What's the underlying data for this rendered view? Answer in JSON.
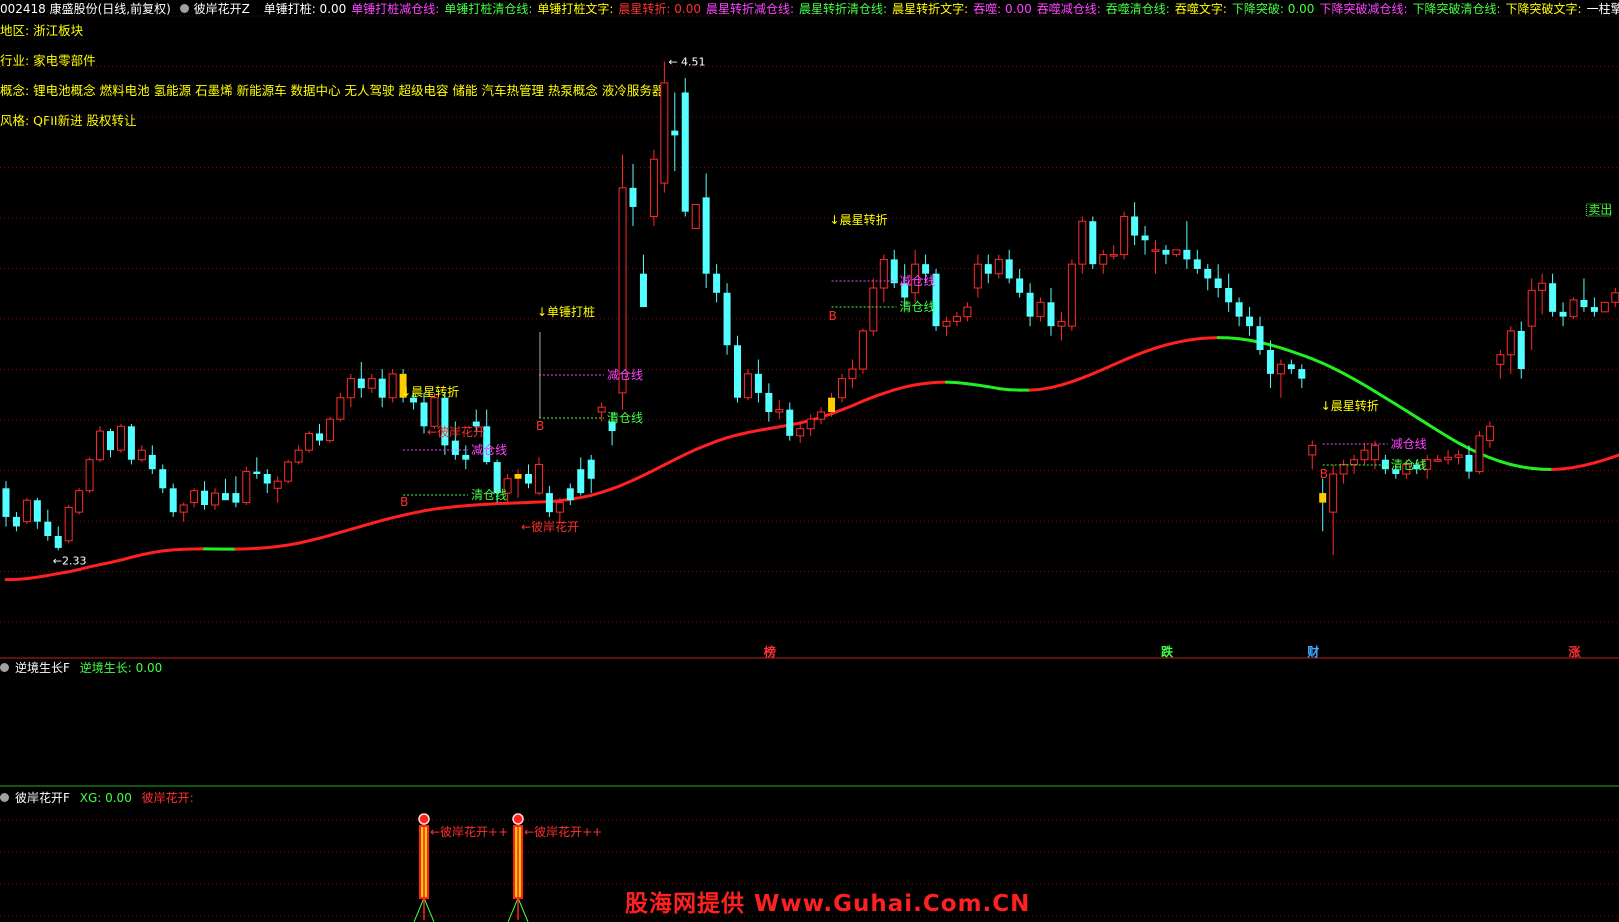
{
  "header": {
    "stock": "002418 康盛股份(日线,前复权)",
    "formula": "彼岸花开Z",
    "items": [
      {
        "label": "单锤打桩: 0.00",
        "color": "#ffffff"
      },
      {
        "label": "单锤打桩减仓线:",
        "color": "#ff44ff"
      },
      {
        "label": "单锤打桩清仓线:",
        "color": "#44ff44"
      },
      {
        "label": "单锤打桩文字:",
        "color": "#ffff00"
      },
      {
        "label": "晨星转折: 0.00",
        "color": "#ff3030"
      },
      {
        "label": "晨星转折减仓线:",
        "color": "#ff44ff"
      },
      {
        "label": "晨星转折清仓线:",
        "color": "#44ff44"
      },
      {
        "label": "晨星转折文字:",
        "color": "#ffff00"
      },
      {
        "label": "吞噬: 0.00",
        "color": "#ff44ff"
      },
      {
        "label": "吞噬减仓线:",
        "color": "#ff44ff"
      },
      {
        "label": "吞噬清仓线:",
        "color": "#44ff44"
      },
      {
        "label": "吞噬文字:",
        "color": "#ffff00"
      },
      {
        "label": "下降突破: 0.00",
        "color": "#44ff44"
      },
      {
        "label": "下降突破减仓线:",
        "color": "#ff44ff"
      },
      {
        "label": "下降突破清仓线:",
        "color": "#44ff44"
      },
      {
        "label": "下降突破文字:",
        "color": "#ffff00"
      },
      {
        "label": "一柱擎天: 0.0",
        "color": "#ffffff"
      }
    ]
  },
  "info": {
    "region": "地区: 浙江板块",
    "industry": "行业: 家电零部件",
    "concept": "概念: 锂电池概念 燃料电池 氢能源 石墨烯 新能源车 数据中心 无人驾驶 超级电容 储能 汽车热管理 热泵概念 液冷服务器",
    "style": "风格: QFII新进 股权转让"
  },
  "panel2": {
    "title": "逆境生长F",
    "value": "逆境生长: 0.00"
  },
  "panel3": {
    "title": "彼岸花开F",
    "xg": "XG: 0.00",
    "label": "彼岸花开:"
  },
  "watermark": "股海网提供 Www.Guhai.Com.CN",
  "colors": {
    "up": "#ff2a2a",
    "down": "#54ffff",
    "ma_up": "#ff2020",
    "ma_down": "#22ee22",
    "signal": "#ffcc00",
    "grid": "#8b0000"
  },
  "chart_data": {
    "type": "candlestick",
    "max_label": "4.51",
    "min_label": "2.33",
    "ylim": [
      2.0,
      4.6
    ],
    "candles": [
      [
        2.72,
        2.75,
        2.56,
        2.6
      ],
      [
        2.6,
        2.62,
        2.54,
        2.56
      ],
      [
        2.58,
        2.68,
        2.57,
        2.67
      ],
      [
        2.67,
        2.68,
        2.55,
        2.58
      ],
      [
        2.58,
        2.63,
        2.5,
        2.52
      ],
      [
        2.52,
        2.56,
        2.46,
        2.47
      ],
      [
        2.5,
        2.65,
        2.49,
        2.64
      ],
      [
        2.62,
        2.72,
        2.61,
        2.71
      ],
      [
        2.71,
        2.85,
        2.7,
        2.84
      ],
      [
        2.84,
        2.98,
        2.83,
        2.96
      ],
      [
        2.96,
        2.97,
        2.85,
        2.88
      ],
      [
        2.88,
        2.99,
        2.87,
        2.98
      ],
      [
        2.98,
        2.99,
        2.82,
        2.84
      ],
      [
        2.84,
        2.9,
        2.83,
        2.88
      ],
      [
        2.86,
        2.9,
        2.78,
        2.8
      ],
      [
        2.8,
        2.82,
        2.7,
        2.72
      ],
      [
        2.72,
        2.74,
        2.6,
        2.62
      ],
      [
        2.62,
        2.66,
        2.58,
        2.65
      ],
      [
        2.66,
        2.72,
        2.64,
        2.71
      ],
      [
        2.71,
        2.75,
        2.63,
        2.65
      ],
      [
        2.65,
        2.72,
        2.63,
        2.7
      ],
      [
        2.7,
        2.76,
        2.68,
        2.67
      ],
      [
        2.7,
        2.77,
        2.64,
        2.66
      ],
      [
        2.66,
        2.81,
        2.65,
        2.79
      ],
      [
        2.79,
        2.85,
        2.76,
        2.78
      ],
      [
        2.78,
        2.8,
        2.7,
        2.74
      ],
      [
        2.72,
        2.77,
        2.66,
        2.75
      ],
      [
        2.75,
        2.84,
        2.74,
        2.83
      ],
      [
        2.83,
        2.9,
        2.82,
        2.88
      ],
      [
        2.88,
        2.96,
        2.87,
        2.95
      ],
      [
        2.95,
        2.99,
        2.9,
        2.92
      ],
      [
        2.92,
        3.02,
        2.91,
        3.01
      ],
      [
        3.01,
        3.12,
        3.0,
        3.1
      ],
      [
        3.1,
        3.2,
        3.06,
        3.18
      ],
      [
        3.18,
        3.25,
        3.1,
        3.14
      ],
      [
        3.14,
        3.2,
        3.12,
        3.18
      ],
      [
        3.18,
        3.22,
        3.06,
        3.1
      ],
      [
        3.1,
        3.22,
        3.08,
        3.2
      ],
      [
        3.2,
        3.22,
        3.08,
        3.1
      ],
      [
        3.1,
        3.12,
        3.05,
        3.08
      ],
      [
        3.08,
        3.12,
        2.95,
        2.98
      ],
      [
        2.98,
        3.12,
        2.97,
        3.1
      ],
      [
        3.1,
        3.12,
        2.86,
        2.9
      ],
      [
        2.92,
        3.0,
        2.84,
        2.86
      ],
      [
        2.86,
        2.9,
        2.8,
        2.84
      ],
      [
        3.0,
        3.05,
        2.96,
        2.98
      ],
      [
        2.98,
        3.05,
        2.82,
        2.83
      ],
      [
        2.83,
        2.84,
        2.66,
        2.7
      ],
      [
        2.7,
        2.78,
        2.66,
        2.76
      ],
      [
        2.76,
        2.8,
        2.68,
        2.78
      ],
      [
        2.78,
        2.82,
        2.72,
        2.74
      ],
      [
        2.7,
        2.85,
        2.69,
        2.82
      ],
      [
        2.7,
        2.73,
        2.6,
        2.62
      ],
      [
        2.62,
        2.68,
        2.58,
        2.66
      ],
      [
        2.72,
        2.74,
        2.65,
        2.67
      ],
      [
        2.8,
        2.85,
        2.69,
        2.7
      ],
      [
        2.84,
        2.86,
        2.7,
        2.76
      ],
      [
        3.04,
        3.08,
        3.0,
        3.06
      ],
      [
        3.0,
        3.04,
        2.9,
        2.96
      ],
      [
        3.12,
        4.12,
        3.05,
        3.98
      ],
      [
        3.98,
        4.08,
        3.82,
        3.9
      ],
      [
        3.62,
        3.7,
        3.48,
        3.48
      ],
      [
        3.86,
        4.14,
        3.82,
        4.1
      ],
      [
        4.0,
        4.51,
        3.96,
        4.42
      ],
      [
        4.22,
        4.38,
        4.05,
        4.2
      ],
      [
        4.38,
        4.44,
        3.86,
        3.88
      ],
      [
        3.81,
        3.91,
        3.81,
        3.91
      ],
      [
        3.94,
        4.04,
        3.56,
        3.62
      ],
      [
        3.62,
        3.66,
        3.5,
        3.54
      ],
      [
        3.54,
        3.58,
        3.28,
        3.32
      ],
      [
        3.32,
        3.36,
        3.08,
        3.1
      ],
      [
        3.1,
        3.22,
        3.09,
        3.2
      ],
      [
        3.2,
        3.26,
        3.08,
        3.12
      ],
      [
        3.12,
        3.16,
        3.0,
        3.04
      ],
      [
        3.04,
        3.09,
        3.01,
        3.05
      ],
      [
        3.05,
        3.08,
        2.92,
        2.94
      ],
      [
        2.94,
        3.0,
        2.91,
        2.97
      ],
      [
        2.97,
        3.03,
        2.94,
        3.01
      ],
      [
        3.01,
        3.06,
        2.99,
        3.04
      ],
      [
        3.04,
        3.12,
        3.02,
        3.1
      ],
      [
        3.1,
        3.2,
        3.08,
        3.18
      ],
      [
        3.18,
        3.26,
        3.14,
        3.22
      ],
      [
        3.22,
        3.39,
        3.2,
        3.38
      ],
      [
        3.38,
        3.6,
        3.36,
        3.56
      ],
      [
        3.56,
        3.7,
        3.5,
        3.68
      ],
      [
        3.68,
        3.72,
        3.56,
        3.58
      ],
      [
        3.58,
        3.66,
        3.48,
        3.52
      ],
      [
        3.54,
        3.72,
        3.5,
        3.66
      ],
      [
        3.66,
        3.7,
        3.58,
        3.62
      ],
      [
        3.62,
        3.64,
        3.38,
        3.4
      ],
      [
        3.4,
        3.44,
        3.36,
        3.42
      ],
      [
        3.42,
        3.46,
        3.4,
        3.44
      ],
      [
        3.44,
        3.5,
        3.42,
        3.48
      ],
      [
        3.56,
        3.7,
        3.52,
        3.66
      ],
      [
        3.66,
        3.7,
        3.58,
        3.62
      ],
      [
        3.62,
        3.7,
        3.6,
        3.68
      ],
      [
        3.68,
        3.72,
        3.58,
        3.6
      ],
      [
        3.6,
        3.64,
        3.52,
        3.54
      ],
      [
        3.54,
        3.58,
        3.4,
        3.44
      ],
      [
        3.44,
        3.52,
        3.42,
        3.5
      ],
      [
        3.5,
        3.56,
        3.36,
        3.4
      ],
      [
        3.4,
        3.46,
        3.34,
        3.42
      ],
      [
        3.4,
        3.68,
        3.38,
        3.66
      ],
      [
        3.66,
        3.86,
        3.62,
        3.84
      ],
      [
        3.84,
        3.86,
        3.64,
        3.66
      ],
      [
        3.66,
        3.72,
        3.62,
        3.7
      ],
      [
        3.7,
        3.74,
        3.68,
        3.7
      ],
      [
        3.7,
        3.88,
        3.68,
        3.86
      ],
      [
        3.86,
        3.92,
        3.74,
        3.78
      ],
      [
        3.78,
        3.82,
        3.7,
        3.76
      ],
      [
        3.72,
        3.76,
        3.62,
        3.72
      ],
      [
        3.72,
        3.74,
        3.66,
        3.7
      ],
      [
        3.7,
        3.72,
        3.69,
        3.72
      ],
      [
        3.72,
        3.84,
        3.64,
        3.68
      ],
      [
        3.68,
        3.72,
        3.62,
        3.64
      ],
      [
        3.64,
        3.66,
        3.55,
        3.6
      ],
      [
        3.6,
        3.66,
        3.52,
        3.56
      ],
      [
        3.56,
        3.62,
        3.46,
        3.5
      ],
      [
        3.5,
        3.52,
        3.4,
        3.44
      ],
      [
        3.44,
        3.48,
        3.36,
        3.4
      ],
      [
        3.4,
        3.44,
        3.28,
        3.3
      ],
      [
        3.3,
        3.34,
        3.14,
        3.2
      ],
      [
        3.2,
        3.26,
        3.1,
        3.24
      ],
      [
        3.24,
        3.26,
        3.2,
        3.22
      ],
      [
        3.22,
        3.24,
        3.14,
        3.18
      ],
      [
        2.86,
        2.92,
        2.8,
        2.9
      ],
      [
        2.7,
        2.76,
        2.54,
        2.66
      ],
      [
        2.62,
        2.82,
        2.44,
        2.78
      ],
      [
        2.78,
        2.84,
        2.74,
        2.82
      ],
      [
        2.82,
        2.86,
        2.78,
        2.84
      ],
      [
        2.84,
        2.91,
        2.82,
        2.88
      ],
      [
        2.84,
        2.92,
        2.8,
        2.9
      ],
      [
        2.84,
        2.86,
        2.78,
        2.8
      ],
      [
        2.8,
        2.82,
        2.76,
        2.78
      ],
      [
        2.78,
        2.84,
        2.76,
        2.82
      ],
      [
        2.82,
        2.84,
        2.78,
        2.8
      ],
      [
        2.8,
        2.86,
        2.76,
        2.84
      ],
      [
        2.84,
        2.86,
        2.83,
        2.84
      ],
      [
        2.84,
        2.88,
        2.82,
        2.85
      ],
      [
        2.85,
        2.88,
        2.82,
        2.86
      ],
      [
        2.86,
        2.9,
        2.76,
        2.79
      ],
      [
        2.79,
        2.96,
        2.78,
        2.94
      ],
      [
        2.92,
        3.0,
        2.89,
        2.98
      ],
      [
        3.24,
        3.3,
        3.18,
        3.28
      ],
      [
        3.28,
        3.4,
        3.2,
        3.38
      ],
      [
        3.38,
        3.42,
        3.18,
        3.22
      ],
      [
        3.4,
        3.6,
        3.3,
        3.55
      ],
      [
        3.55,
        3.62,
        3.45,
        3.58
      ],
      [
        3.58,
        3.62,
        3.44,
        3.46
      ],
      [
        3.46,
        3.5,
        3.4,
        3.44
      ],
      [
        3.44,
        3.52,
        3.43,
        3.51
      ],
      [
        3.51,
        3.6,
        3.46,
        3.48
      ],
      [
        3.48,
        3.52,
        3.44,
        3.46
      ],
      [
        3.46,
        3.5,
        3.46,
        3.5
      ],
      [
        3.5,
        3.56,
        3.48,
        3.54
      ],
      [
        3.54,
        3.58,
        3.48,
        3.5
      ],
      [
        3.5,
        3.52,
        3.46,
        3.48
      ],
      [
        3.48,
        3.56,
        3.45,
        3.54
      ],
      [
        3.54,
        3.56,
        3.46,
        3.47
      ],
      [
        3.47,
        3.54,
        3.42,
        3.52
      ],
      [
        3.52,
        3.56,
        3.48,
        3.54
      ],
      [
        3.54,
        3.6,
        3.5,
        3.57
      ],
      [
        3.57,
        3.59,
        3.46,
        3.48
      ],
      [
        3.48,
        3.5,
        3.4,
        3.44
      ],
      [
        3.44,
        3.48,
        3.4,
        3.46
      ],
      [
        3.46,
        3.5,
        3.42,
        3.44
      ],
      [
        3.44,
        3.52,
        3.42,
        3.5
      ],
      [
        3.42,
        3.76,
        3.4,
        3.74
      ],
      [
        3.74,
        3.75,
        3.55,
        3.56
      ],
      [
        3.62,
        3.82,
        3.6,
        3.8
      ],
      [
        3.8,
        3.92,
        3.76,
        3.86
      ],
      [
        3.86,
        3.9,
        3.78,
        3.8
      ],
      [
        3.8,
        3.85,
        3.76,
        3.83
      ],
      [
        3.82,
        3.85,
        3.76,
        3.78
      ],
      [
        3.78,
        3.82,
        3.64,
        3.66
      ],
      [
        3.66,
        3.74,
        3.6,
        3.72
      ],
      [
        3.72,
        3.74,
        3.56,
        3.58
      ],
      [
        3.58,
        3.64,
        3.56,
        3.6
      ],
      [
        3.62,
        3.66,
        3.54,
        3.64
      ],
      [
        3.64,
        3.7,
        3.62,
        3.59
      ]
    ],
    "markers": [
      {
        "label": "晨星转折",
        "i": 38
      },
      {
        "label": "单锤打桩",
        "i": 51
      },
      {
        "label": "晨星转折",
        "i": 79
      },
      {
        "label": "晨星转折",
        "i": 126
      },
      {
        "label": "清仓线",
        "i": 44
      },
      {
        "label": "减仓线",
        "i": 43
      },
      {
        "label": "减仓线",
        "i": 60
      },
      {
        "label": "清仓线",
        "i": 60
      },
      {
        "label": "减仓线",
        "i": 86
      },
      {
        "label": "清仓线",
        "i": 86
      },
      {
        "label": "减仓线",
        "i": 133
      },
      {
        "label": "清仓线",
        "i": 133
      },
      {
        "label": "彼岸花开",
        "i": 40
      },
      {
        "label": "彼岸花开",
        "i": 49
      },
      {
        "label": "卖出",
        "i": 152
      }
    ],
    "b_text": "B",
    "bottom_tags": [
      {
        "text": "榜",
        "i": 73,
        "color": "#ff3030"
      },
      {
        "text": "跌",
        "i": 111,
        "color": "#44ff44"
      },
      {
        "text": "财",
        "i": 125,
        "color": "#44aaff"
      },
      {
        "text": "涨",
        "i": 150,
        "color": "#ff3030"
      }
    ],
    "panel3_label": "彼岸花开++"
  }
}
